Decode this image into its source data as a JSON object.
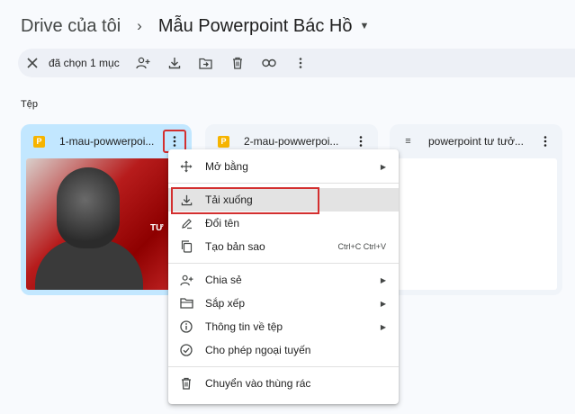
{
  "breadcrumb": {
    "root": "Drive của tôi",
    "separator": "›",
    "current": "Mẫu Powerpoint Bác Hồ",
    "caret": "▼"
  },
  "selection_toolbar": {
    "count_label": "đã chọn 1 mục",
    "icons": [
      "close-icon",
      "add-person-icon",
      "download-icon",
      "move-to-folder-icon",
      "trash-icon",
      "link-icon",
      "more-vert-icon"
    ]
  },
  "section": {
    "files_label": "Tệp"
  },
  "files": [
    {
      "name": "1-mau-powwerpoi...",
      "type_badge": "P",
      "selected": true,
      "thumb_text": "TƯ"
    },
    {
      "name": "2-mau-powwerpoi...",
      "type_badge": "P",
      "selected": false
    },
    {
      "name": "powerpoint tư tưở...",
      "type_badge": "≡",
      "selected": false
    }
  ],
  "context_menu": {
    "items": [
      {
        "label": "Mở bằng",
        "icon": "open-with-icon",
        "has_submenu": true
      },
      {
        "label": "Tải xuống",
        "icon": "download-icon"
      },
      {
        "label": "Đổi tên",
        "icon": "rename-icon"
      },
      {
        "label": "Tạo bản sao",
        "icon": "copy-icon",
        "shortcut": "Ctrl+C Ctrl+V"
      },
      {
        "label": "Chia sẻ",
        "icon": "share-icon",
        "has_submenu": true
      },
      {
        "label": "Sắp xếp",
        "icon": "folder-organize-icon",
        "has_submenu": true
      },
      {
        "label": "Thông tin về tệp",
        "icon": "info-icon",
        "has_submenu": true
      },
      {
        "label": "Cho phép ngoại tuyến",
        "icon": "offline-icon"
      },
      {
        "label": "Chuyển vào thùng rác",
        "icon": "trash-icon"
      }
    ]
  },
  "colors": {
    "selected_card": "#c2e7ff",
    "highlight_box": "#d32f2f",
    "pptx_badge": "#f6b400"
  }
}
